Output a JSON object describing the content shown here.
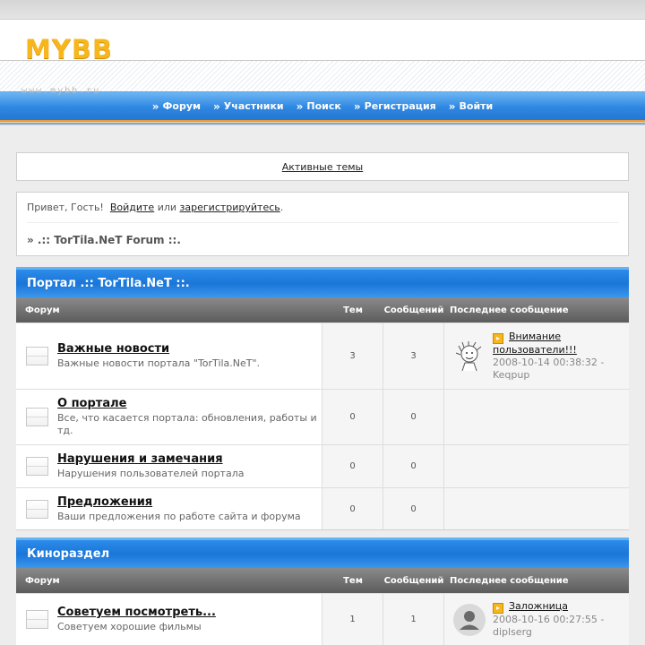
{
  "header": {
    "logo": "MYBB",
    "logo_sub": "www.mybb.ru"
  },
  "nav": {
    "items": [
      {
        "label": "Форум"
      },
      {
        "label": "Участники"
      },
      {
        "label": "Поиск"
      },
      {
        "label": "Регистрация"
      },
      {
        "label": "Войти"
      }
    ]
  },
  "active_topics": {
    "label": "Активные темы"
  },
  "welcome": {
    "greeting": "Привет, Гость!",
    "login": "Войдите",
    "or": "или",
    "register": "зарегистрируйтесь",
    "breadcrumb": "» .:: TorTila.NeT Forum ::."
  },
  "columns": {
    "forum": "Форум",
    "topics": "Тем",
    "posts": "Сообщений",
    "last": "Последнее сообщение"
  },
  "categories": [
    {
      "title": "Портал .:: TorTila.NeT ::.",
      "forums": [
        {
          "name": "Важные новости",
          "desc": "Важные новости портала \"TorTila.NeT\".",
          "topics": "3",
          "posts": "3",
          "last_title": "Внимание пользователи!!!",
          "last_meta": "2008-10-14 00:38:32 - Keqpup",
          "avatar": "sketch-avatar-icon"
        },
        {
          "name": "О портале",
          "desc": "Все, что касается портала: обновления, работы и тд.",
          "topics": "0",
          "posts": "0"
        },
        {
          "name": "Нарушения и замечания",
          "desc": "Нарушения пользователей портала",
          "topics": "0",
          "posts": "0"
        },
        {
          "name": "Предложения",
          "desc": "Ваши предложения по работе сайта и форума",
          "topics": "0",
          "posts": "0"
        }
      ]
    },
    {
      "title": "Кинораздел",
      "forums": [
        {
          "name": "Советуем посмотреть...",
          "desc": "Советуем хорошие фильмы",
          "topics": "1",
          "posts": "1",
          "last_title": "Заложница",
          "last_meta": "2008-10-16 00:27:55 - diplserg",
          "avatar": "default-user-icon"
        }
      ]
    }
  ],
  "colors": {
    "nav_blue": "#2f87e2",
    "category_blue": "#1a76d8",
    "logo_gold": "#f6b61c",
    "column_header_grey": "#5c5c5c"
  }
}
